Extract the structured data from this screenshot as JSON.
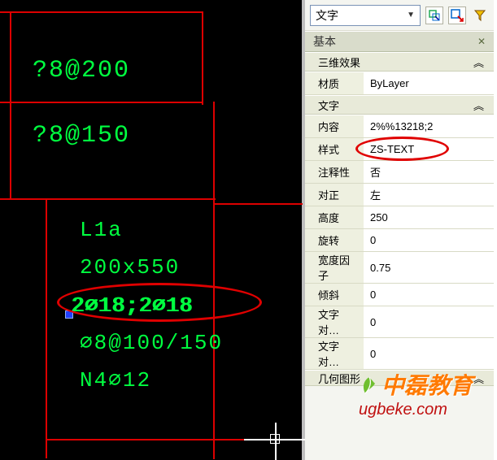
{
  "panel": {
    "type_selector": "文字",
    "toolbar_icons": [
      "selection-box-icon",
      "quick-select-icon",
      "filter-icon"
    ],
    "sections": {
      "basic": {
        "title": "基本"
      },
      "three_d": {
        "title": "三维效果",
        "rows": {
          "material": {
            "label": "材质",
            "value": "ByLayer"
          }
        }
      },
      "text": {
        "title": "文字",
        "rows": {
          "content": {
            "label": "内容",
            "value": "2%%13218;2"
          },
          "style": {
            "label": "样式",
            "value": "ZS-TEXT"
          },
          "annot": {
            "label": "注释性",
            "value": "否"
          },
          "justify": {
            "label": "对正",
            "value": "左"
          },
          "height": {
            "label": "高度",
            "value": "250"
          },
          "rotation": {
            "label": "旋转",
            "value": "0"
          },
          "widthf": {
            "label": "宽度因子",
            "value": "0.75"
          },
          "oblique": {
            "label": "倾斜",
            "value": "0"
          },
          "alignx": {
            "label": "文字对…",
            "value": "0"
          },
          "aligny": {
            "label": "文字对…",
            "value": "0"
          }
        }
      },
      "geom": {
        "title": "几何图形"
      }
    }
  },
  "cad": {
    "lines": {
      "t1": "?8@200",
      "t2": "?8@150",
      "l1": "L1a",
      "l2": "200x550",
      "l3": "2⌀18;2⌀18",
      "l4": "⌀8@100/150",
      "l5": "N4⌀12"
    }
  },
  "watermark": {
    "brand": "中磊教育",
    "url": "ugbeke.com"
  }
}
